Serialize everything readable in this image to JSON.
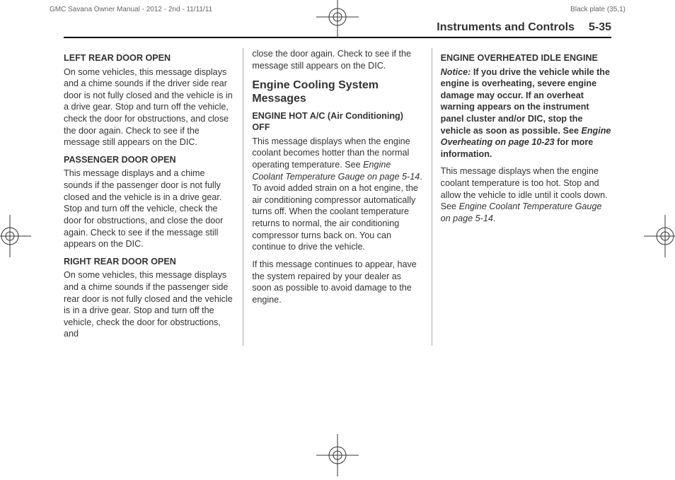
{
  "meta": {
    "doc_id": "GMC Savana Owner Manual - 2012 - 2nd - 11/11/11",
    "plate": "Black plate (35,1)"
  },
  "header": {
    "section": "Instruments and Controls",
    "page": "5-35"
  },
  "col1": {
    "h1": "LEFT REAR DOOR OPEN",
    "p1": "On some vehicles, this message displays and a chime sounds if the driver side rear door is not fully closed and the vehicle is in a drive gear. Stop and turn off the vehicle, check the door for obstructions, and close the door again. Check to see if the message still appears on the DIC.",
    "h2": "PASSENGER DOOR OPEN",
    "p2": "This message displays and a chime sounds if the passenger door is not fully closed and the vehicle is in a drive gear. Stop and turn off the vehicle, check the door for obstructions, and close the door again. Check to see if the message still appears on the DIC.",
    "h3": "RIGHT REAR DOOR OPEN",
    "p3": "On some vehicles, this message displays and a chime sounds if the passenger side rear door is not fully closed and the vehicle is in a drive gear. Stop and turn off the vehicle, check the door for obstructions, and"
  },
  "col2": {
    "p0": "close the door again. Check to see if the message still appears on the DIC.",
    "h_section": "Engine Cooling System Messages",
    "h1": "ENGINE HOT A/C (Air Conditioning) OFF",
    "p1a": "This message displays when the engine coolant becomes hotter than the normal operating temperature. See ",
    "p1ref": "Engine Coolant Temperature Gauge on page 5-14",
    "p1b": ". To avoid added strain on a hot engine, the air conditioning compressor automatically turns off. When the coolant temperature returns to normal, the air conditioning compressor turns back on. You can continue to drive the vehicle.",
    "p2": "If this message continues to appear, have the system repaired by your dealer as soon as possible to avoid damage to the engine."
  },
  "col3": {
    "h1": "ENGINE OVERHEATED IDLE ENGINE",
    "notice_label": "Notice:",
    "notice_a": "If you drive the vehicle while the engine is overheating, severe engine damage may occur. If an overheat warning appears on the instrument panel cluster and/or DIC, stop the vehicle as soon as possible. See ",
    "notice_ref": "Engine Overheating on page 10-23",
    "notice_b": " for more information.",
    "p1a": "This message displays when the engine coolant temperature is too hot. Stop and allow the vehicle to idle until it cools down. See ",
    "p1ref": "Engine Coolant Temperature Gauge on page 5-14",
    "p1b": "."
  }
}
